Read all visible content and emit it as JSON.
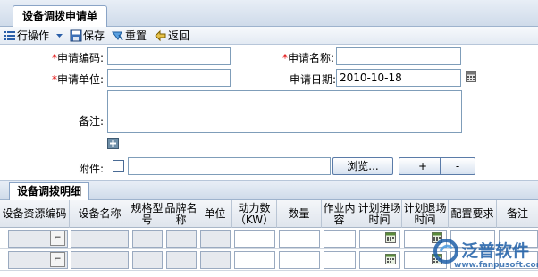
{
  "title_tab": "设备调拨申请单",
  "toolbar": {
    "row_ops": "行操作",
    "save": "保存",
    "reset": "重置",
    "back": "返回"
  },
  "form": {
    "req_mark": "*",
    "apply_code_label": "申请编码:",
    "apply_name_label": "申请名称:",
    "apply_unit_label": "申请单位:",
    "apply_date_label": "申请日期:",
    "apply_date_value": "2010-10-18",
    "remark_label": "备注:",
    "attachment_label": "附件:",
    "browse_label": "浏览...",
    "add_label": "+",
    "remove_label": "-"
  },
  "detail": {
    "tab": "设备调拨明细",
    "columns": [
      "设备资源编码",
      "设备名称",
      "规格型号",
      "品牌名称",
      "单位",
      "动力数（KW）",
      "数量",
      "作业内容",
      "计划进场时间",
      "计划退场时间",
      "配置要求",
      "备注"
    ],
    "row_count": 2
  },
  "watermark": {
    "brand": "泛普软件",
    "url": "www.fanpusoft.com"
  },
  "colors": {
    "required": "#e00000",
    "input_border": "#7f9db9",
    "header_blue": "#cfdbea",
    "logo_blue": "#1e5fa8"
  }
}
